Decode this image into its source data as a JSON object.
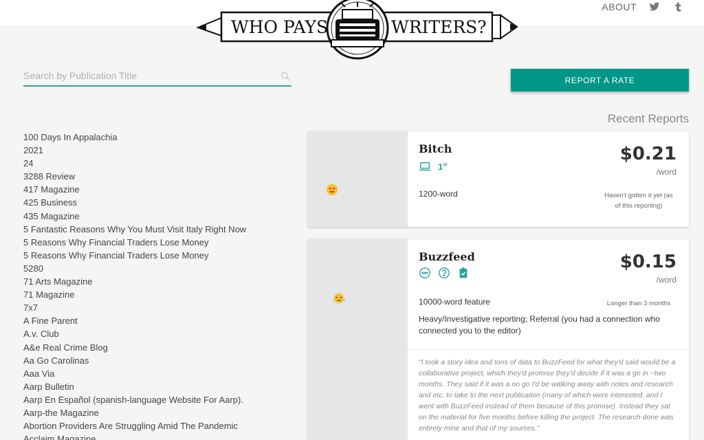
{
  "logo": {
    "text_left": "WHO PAYS",
    "text_right": "WRITERS?"
  },
  "nav": {
    "about": "ABOUT",
    "icons": [
      "twitter-icon",
      "tumblr-icon"
    ]
  },
  "search": {
    "placeholder": "Search by Publication Title"
  },
  "report_button": "REPORT A RATE",
  "recent_title": "Recent Reports",
  "colors": {
    "accent": "#009688",
    "accent_light": "#26a69a",
    "rate_panel": "#e6e6e6"
  },
  "publications": [
    "100 Days In Appalachia",
    "2021",
    "24",
    "3288 Review",
    "417 Magazine",
    "425 Business",
    "435 Magazine",
    "5 Fantastic Reasons Why You Must Visit Italy Right Now",
    "5 Reasons Why Financial Traders Lose Money",
    "5 Reasons Why Financial Traders Lose Money",
    "5280",
    "71 Arts Magazine",
    "71 Magazine",
    "7x7",
    "A Fine Parent",
    "A.v. Club",
    "A&e Real Crime Blog",
    "Aa Go Carolinas",
    "Aaa Via",
    "Aarp Bulletin",
    "Aarp En Español (spanish-language Website For Aarp).",
    "Aarp-the Magazine",
    "Abortion Providers Are Struggling Amid The Pandemic",
    "Acclaim Magazine"
  ],
  "reports": [
    {
      "rate": "$0.21",
      "unit": "/word",
      "emoji": "heart-eyes-emoji",
      "status": "Haven't gotten it yet (as of this reporting)",
      "publication": "Bitch",
      "icons": [
        "laptop-icon"
      ],
      "order_label": "1",
      "order_suffix": "st",
      "details": [
        "1200-word"
      ]
    },
    {
      "rate": "$0.15",
      "unit": "/word",
      "emoji": "steaming-face-emoji",
      "status": "Longer than 3 months",
      "publication": "Buzzfeed",
      "icons": [
        "dots-circle-icon",
        "question-circle-icon",
        "clipboard-check-icon"
      ],
      "details": [
        "10000-word feature",
        "Heavy/Investigative reporting; Referral (you had a connection who connected you to the editor)"
      ],
      "note": "\"I took a story idea and tons of data to BuzzFeed for what they'd said would be a collaborative project, which they'd promise they'd decide if it was a go in ~two months. They said if it was a no go I'd be walking away with notes and research and etc. to take to the next publication (many of which were interested, and I went with BuzzFeed instead of them because of this promise). Instead they sat on the material for five months before killing the project. The research done was entirely mine and that of my sources.\""
    }
  ]
}
